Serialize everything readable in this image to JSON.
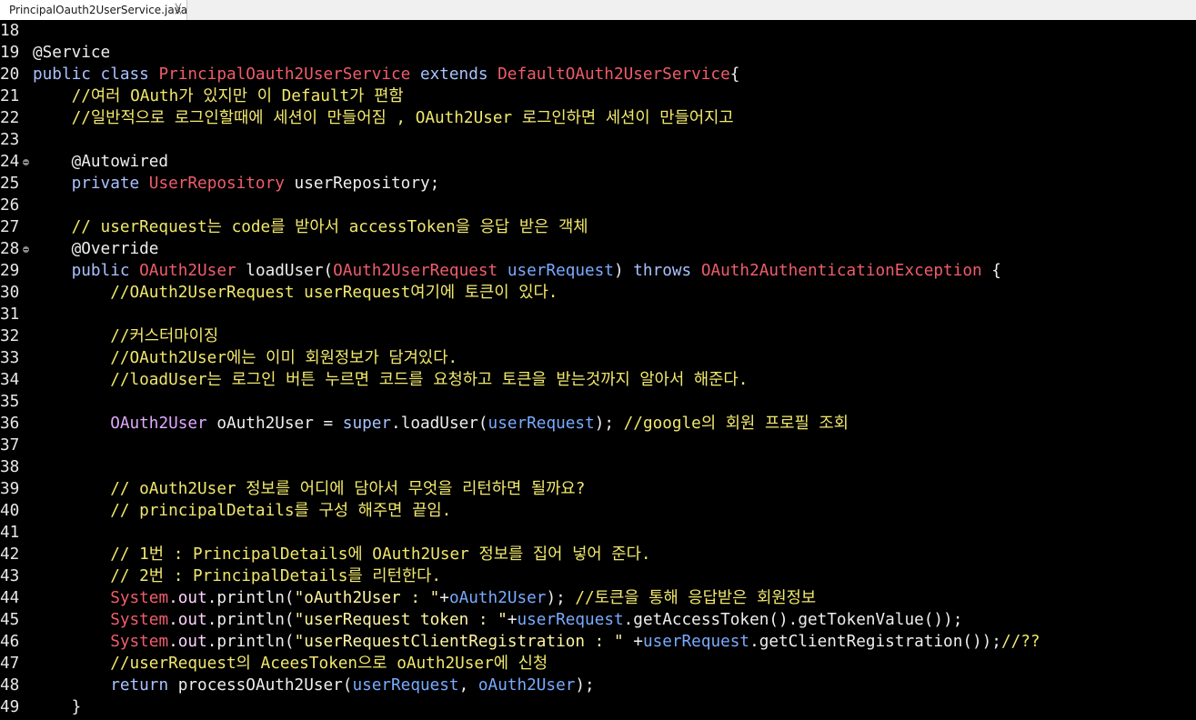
{
  "tab": {
    "title": "PrincipalOauth2UserService.java"
  },
  "colors": {
    "background": "#000000",
    "keyword": "#a8c2ff",
    "class": "#ef5d6b",
    "comment": "#f1e86c",
    "variable": "#79abff"
  },
  "lines": [
    {
      "n": "18",
      "fold": false,
      "t": []
    },
    {
      "n": "19",
      "fold": false,
      "t": [
        [
          "@Service",
          "plain"
        ]
      ]
    },
    {
      "n": "20",
      "fold": false,
      "t": [
        [
          "public class ",
          "kw2"
        ],
        [
          "PrincipalOauth2UserService",
          "cls"
        ],
        [
          " extends ",
          "kw2"
        ],
        [
          "DefaultOAuth2UserService",
          "cls"
        ],
        [
          "{",
          "plain"
        ]
      ]
    },
    {
      "n": "21",
      "fold": false,
      "t": [
        [
          "    //여러 OAuth가 있지만 이 Default가 편함",
          "cmt"
        ]
      ]
    },
    {
      "n": "22",
      "fold": false,
      "t": [
        [
          "    //일반적으로 로그인할때에 세션이 만들어짐 , OAuth2User 로그인하면 세션이 만들어지고",
          "cmt"
        ]
      ]
    },
    {
      "n": "23",
      "fold": false,
      "t": []
    },
    {
      "n": "24",
      "fold": true,
      "t": [
        [
          "    @Autowired",
          "plain"
        ]
      ]
    },
    {
      "n": "25",
      "fold": false,
      "t": [
        [
          "    private ",
          "kw2"
        ],
        [
          "UserRepository",
          "cls"
        ],
        [
          " userRepository;",
          "plain"
        ]
      ]
    },
    {
      "n": "26",
      "fold": false,
      "t": []
    },
    {
      "n": "27",
      "fold": false,
      "t": [
        [
          "    // userRequest는 code를 받아서 accessToken을 응답 받은 객체",
          "cmt"
        ]
      ]
    },
    {
      "n": "28",
      "fold": true,
      "t": [
        [
          "    @Override",
          "plain"
        ]
      ]
    },
    {
      "n": "29",
      "fold": false,
      "t": [
        [
          "    public ",
          "kw2"
        ],
        [
          "OAuth2User",
          "cls"
        ],
        [
          " loadUser(",
          "plain"
        ],
        [
          "OAuth2UserRequest",
          "cls"
        ],
        [
          " userRequest",
          "var"
        ],
        [
          ") ",
          "plain"
        ],
        [
          "throws ",
          "kw2"
        ],
        [
          "OAuth2AuthenticationException",
          "cls"
        ],
        [
          " {",
          "plain"
        ]
      ]
    },
    {
      "n": "30",
      "fold": false,
      "t": [
        [
          "        //OAuth2UserRequest userRequest여기에 토큰이 있다.",
          "cmt"
        ]
      ]
    },
    {
      "n": "31",
      "fold": false,
      "t": []
    },
    {
      "n": "32",
      "fold": false,
      "t": [
        [
          "        //커스터마이징",
          "cmt"
        ]
      ]
    },
    {
      "n": "33",
      "fold": false,
      "t": [
        [
          "        //OAuth2User에는 이미 회원정보가 담겨있다.",
          "cmt"
        ]
      ]
    },
    {
      "n": "34",
      "fold": false,
      "t": [
        [
          "        //loadUser는 로그인 버튼 누르면 코드를 요청하고 토큰을 받는것까지 알아서 해준다.",
          "cmt"
        ]
      ]
    },
    {
      "n": "35",
      "fold": false,
      "t": []
    },
    {
      "n": "36",
      "fold": false,
      "t": [
        [
          "        ",
          "plain"
        ],
        [
          "OAuth2User",
          "fld"
        ],
        [
          " oAuth2User = ",
          "plain"
        ],
        [
          "super",
          "kw2"
        ],
        [
          ".loadUser(",
          "plain"
        ],
        [
          "userRequest",
          "var"
        ],
        [
          "); ",
          "plain"
        ],
        [
          "//google의 회원 프로필 조회",
          "cmt"
        ]
      ]
    },
    {
      "n": "37",
      "fold": false,
      "t": []
    },
    {
      "n": "38",
      "fold": false,
      "t": []
    },
    {
      "n": "39",
      "fold": false,
      "t": [
        [
          "        // oAuth2User 정보를 어디에 담아서 무엇을 리턴하면 될까요?",
          "cmt"
        ]
      ]
    },
    {
      "n": "40",
      "fold": false,
      "t": [
        [
          "        // principalDetails를 구성 해주면 끝임.",
          "cmt"
        ]
      ]
    },
    {
      "n": "41",
      "fold": false,
      "t": []
    },
    {
      "n": "42",
      "fold": false,
      "t": [
        [
          "        // 1번 : PrincipalDetails에 OAuth2User 정보를 집어 넣어 준다.",
          "cmt"
        ]
      ]
    },
    {
      "n": "43",
      "fold": false,
      "t": [
        [
          "        // 2번 : PrincipalDetails를 리턴한다.",
          "cmt"
        ]
      ]
    },
    {
      "n": "44",
      "fold": false,
      "t": [
        [
          "        ",
          "plain"
        ],
        [
          "System",
          "sys"
        ],
        [
          ".",
          "plain"
        ],
        [
          "out",
          "out"
        ],
        [
          ".println(",
          "plain"
        ],
        [
          "\"oAuth2User : \"",
          "str"
        ],
        [
          "+",
          "plain"
        ],
        [
          "oAuth2User",
          "var"
        ],
        [
          "); ",
          "plain"
        ],
        [
          "//토큰을 통해 응답받은 회원정보",
          "cmt"
        ]
      ]
    },
    {
      "n": "45",
      "fold": false,
      "t": [
        [
          "        ",
          "plain"
        ],
        [
          "System",
          "sys"
        ],
        [
          ".",
          "plain"
        ],
        [
          "out",
          "out"
        ],
        [
          ".println(",
          "plain"
        ],
        [
          "\"userRequest token : \"",
          "str"
        ],
        [
          "+",
          "plain"
        ],
        [
          "userRequest",
          "var"
        ],
        [
          ".getAccessToken().getTokenValue());",
          "plain"
        ]
      ]
    },
    {
      "n": "46",
      "fold": false,
      "t": [
        [
          "        ",
          "plain"
        ],
        [
          "System",
          "sys"
        ],
        [
          ".",
          "plain"
        ],
        [
          "out",
          "out"
        ],
        [
          ".println(",
          "plain"
        ],
        [
          "\"userRequestClientRegistration : \"",
          "str"
        ],
        [
          " +",
          "plain"
        ],
        [
          "userRequest",
          "var"
        ],
        [
          ".getClientRegistration());",
          "plain"
        ],
        [
          "//??",
          "cmt"
        ]
      ]
    },
    {
      "n": "47",
      "fold": false,
      "t": [
        [
          "        //userRequest의 AceesToken으로 oAuth2User에 신청",
          "cmt"
        ]
      ]
    },
    {
      "n": "48",
      "fold": false,
      "t": [
        [
          "        ",
          "plain"
        ],
        [
          "return",
          "kw2"
        ],
        [
          " processOAuth2User(",
          "plain"
        ],
        [
          "userRequest",
          "var"
        ],
        [
          ", ",
          "plain"
        ],
        [
          "oAuth2User",
          "var"
        ],
        [
          ");",
          "plain"
        ]
      ]
    },
    {
      "n": "49",
      "fold": false,
      "t": [
        [
          "    }",
          "plain"
        ]
      ]
    }
  ]
}
